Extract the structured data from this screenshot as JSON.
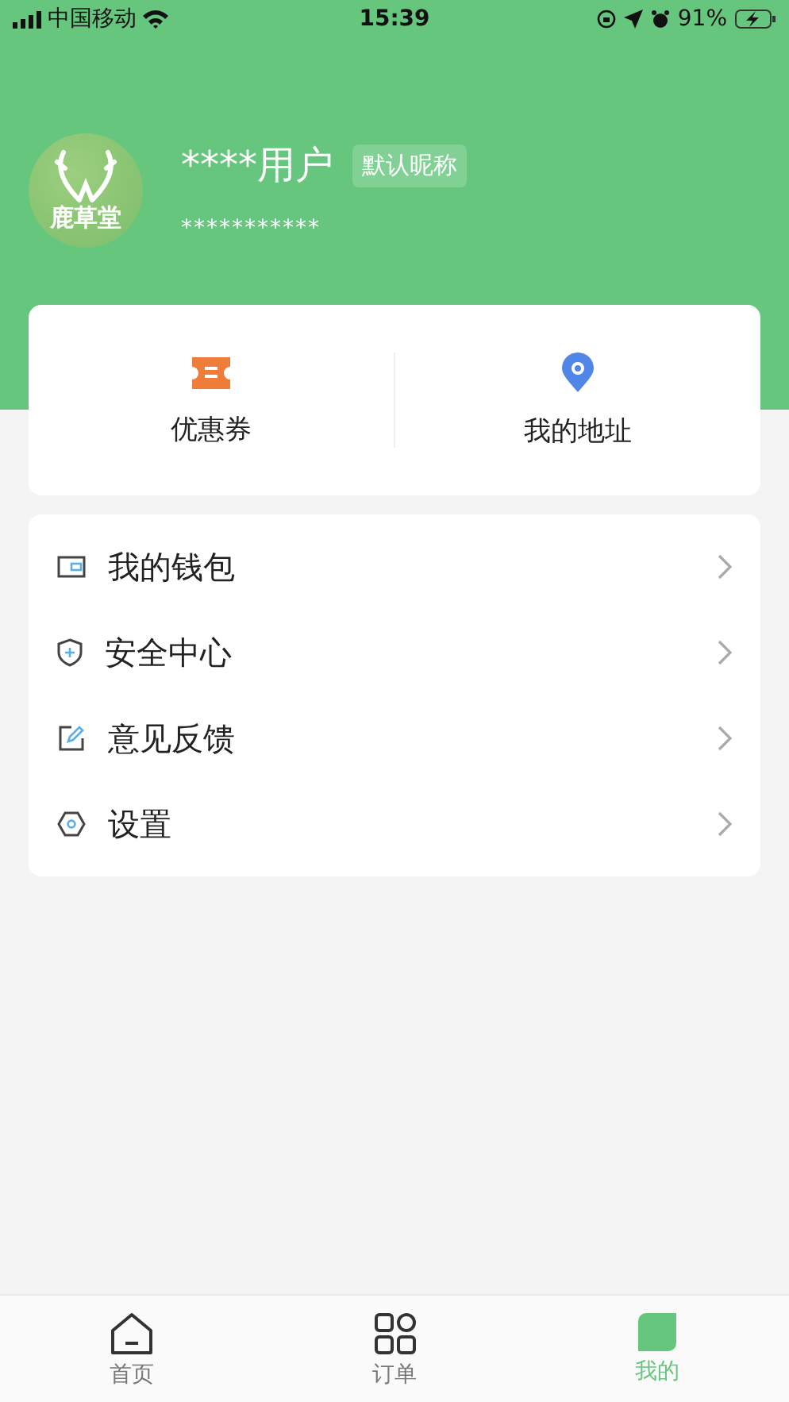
{
  "status_bar": {
    "carrier": "中国移动",
    "time": "15:39",
    "battery": "91%"
  },
  "profile": {
    "logo_text": "鹿草堂",
    "name": "****用户",
    "nickname_badge": "默认昵称",
    "phone": "***********"
  },
  "shortcuts": [
    {
      "label": "优惠券"
    },
    {
      "label": "我的地址"
    }
  ],
  "menu": [
    {
      "label": "我的钱包"
    },
    {
      "label": "安全中心"
    },
    {
      "label": "意见反馈"
    },
    {
      "label": "设置"
    }
  ],
  "tabs": [
    {
      "label": "首页",
      "selected": false
    },
    {
      "label": "订单",
      "selected": false
    },
    {
      "label": "我的",
      "selected": true
    }
  ]
}
